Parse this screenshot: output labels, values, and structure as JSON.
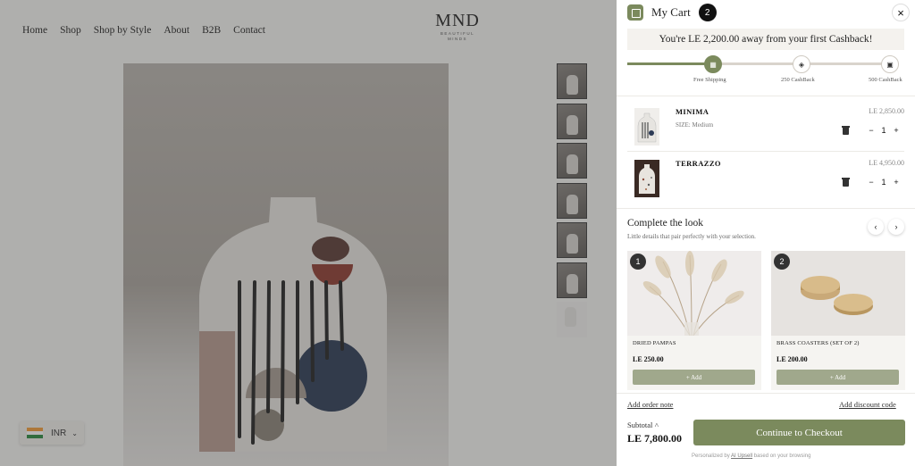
{
  "nav": {
    "items": [
      "Home",
      "Shop",
      "Shop by Style",
      "About",
      "B2B",
      "Contact"
    ]
  },
  "logo": {
    "mark": "MND",
    "sub": "BEAUTIFUL MINDS"
  },
  "currency": {
    "code": "INR"
  },
  "cart": {
    "title": "My Cart",
    "count": "2",
    "close": "×",
    "banner": "You're LE 2,200.00 away from your first Cashback!",
    "progress_fraction": 0.3,
    "milestones": [
      {
        "label": "Free Shipping",
        "icon": "truck-icon",
        "done": true
      },
      {
        "label": "250 CashBack",
        "icon": "tag-icon",
        "done": false
      },
      {
        "label": "500 CashBack",
        "icon": "gift-icon",
        "done": false
      }
    ],
    "items": [
      {
        "name": "MINIMA",
        "variant": "SIZE: Medium",
        "price": "LE 2,850.00",
        "qty": "1"
      },
      {
        "name": "TERRAZZO",
        "variant": "",
        "price": "LE 4,950.00",
        "qty": "1"
      }
    ],
    "qty_minus": "−",
    "qty_plus": "+",
    "complete_look": {
      "title": "Complete the look",
      "subtitle": "Little details that pair perfectly with your selection.",
      "prev": "‹",
      "next": "›",
      "products": [
        {
          "num": "1",
          "name": "DRIED PAMPAS",
          "price": "LE 250.00",
          "add": "+ Add"
        },
        {
          "num": "2",
          "name": "BRASS COASTERS (SET OF 2)",
          "price": "LE 200.00",
          "add": "+ Add"
        }
      ]
    },
    "add_note": "Add order note",
    "add_discount": "Add discount code",
    "subtotal_label": "Subtotal ˄",
    "subtotal_value": "LE 7,800.00",
    "checkout": "Continue to Checkout",
    "footer_pre": "Personalized by",
    "footer_link": "AI Upsell",
    "footer_post": "based on your browsing",
    "colors": {
      "accent": "#7b8a5d",
      "add_button": "#a0a88c"
    }
  }
}
